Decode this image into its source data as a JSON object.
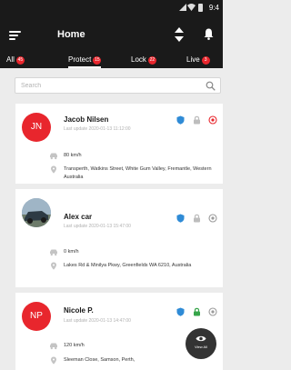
{
  "status_bar": {
    "time": "9:4",
    "icons": [
      "signal-icon",
      "wifi-icon",
      "battery-icon"
    ]
  },
  "header": {
    "title": "Home",
    "icons": [
      "menu-icon",
      "sort-icon",
      "bell-icon"
    ]
  },
  "tabs": [
    {
      "label": "All",
      "count": "45",
      "active": false
    },
    {
      "label": "Protect",
      "count": "15",
      "active": true
    },
    {
      "label": "Lock",
      "count": "22",
      "active": false
    },
    {
      "label": "Live",
      "count": "3",
      "active": false
    }
  ],
  "search": {
    "placeholder": "Search",
    "icon": "search-icon"
  },
  "vehicles": [
    {
      "initials": "JN",
      "avatar_type": "initials",
      "name": "Jacob Nilsen",
      "last_update": "Last update 2020-01-13 11:12:00",
      "speed": "80 km/h",
      "address": "Transperth, Watkins Street, White Gum Valley, Fremantle, Western Australia",
      "status_icons": [
        "shield-icon",
        "lock-icon",
        "power-icon"
      ]
    },
    {
      "initials": "",
      "avatar_type": "photo",
      "name": "Alex car",
      "last_update": "Last update 2020-01-13 15:47:00",
      "speed": "0 km/h",
      "address": "Lakes Rd & Minilya Pkwy, Greenfields WA 6210, Australia",
      "status_icons": [
        "shield-icon",
        "lock-icon",
        "power-icon"
      ]
    },
    {
      "initials": "NP",
      "avatar_type": "initials",
      "name": "Nicole P.",
      "last_update": "Last update 2020-01-13 14:47:00",
      "speed": "120 km/h",
      "address": "Sleeman Close, Samson, Perth,",
      "status_icons": [
        "shield-icon",
        "lock-icon",
        "power-icon"
      ]
    }
  ],
  "fab": {
    "label": "View All",
    "icon": "eye-icon"
  },
  "colors": {
    "primary": "#1a1a1a",
    "badge": "#e8262d",
    "shield": "#2f8bd6",
    "lock_on": "#37a54a",
    "background": "#ececec"
  }
}
